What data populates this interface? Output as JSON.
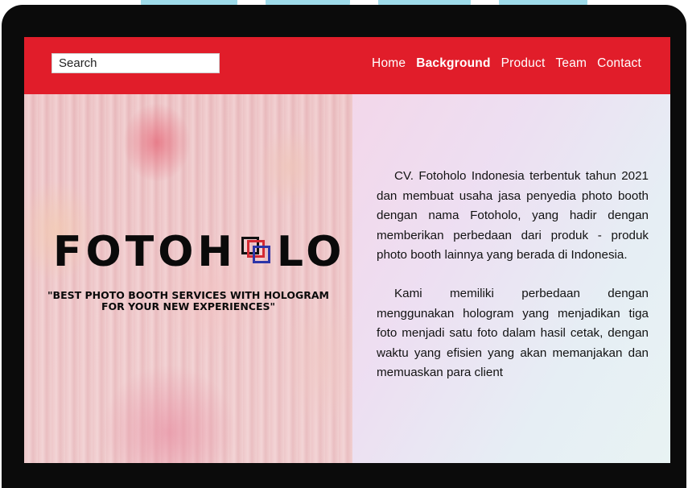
{
  "nav": {
    "search_placeholder": "Search",
    "links": [
      {
        "label": "Home",
        "active": false
      },
      {
        "label": "Background",
        "active": true
      },
      {
        "label": "Product",
        "active": false
      },
      {
        "label": "Team",
        "active": false
      },
      {
        "label": "Contact",
        "active": false
      }
    ],
    "bar_color": "#e11d2a"
  },
  "hero": {
    "logo_left": "FOTOH",
    "logo_right": "LO",
    "tagline": "\"BEST PHOTO BOOTH SERVICES WITH HOLOGRAM FOR YOUR NEW EXPERIENCES\"",
    "logo_mark_colors": [
      "#101010",
      "#d42a33",
      "#2d35a8"
    ]
  },
  "about": {
    "paragraphs": [
      "CV. Fotoholo Indonesia terbentuk tahun 2021 dan membuat usaha jasa penyedia photo booth dengan nama Fotoholo, yang hadir dengan memberikan perbedaan dari produk - produk photo booth lainnya yang berada di Indonesia.",
      "Kami memiliki perbedaan dengan menggunakan hologram yang menjadikan tiga foto menjadi satu foto dalam hasil cetak, dengan waktu yang efisien yang akan memanjakan dan memuaskan para client"
    ]
  }
}
